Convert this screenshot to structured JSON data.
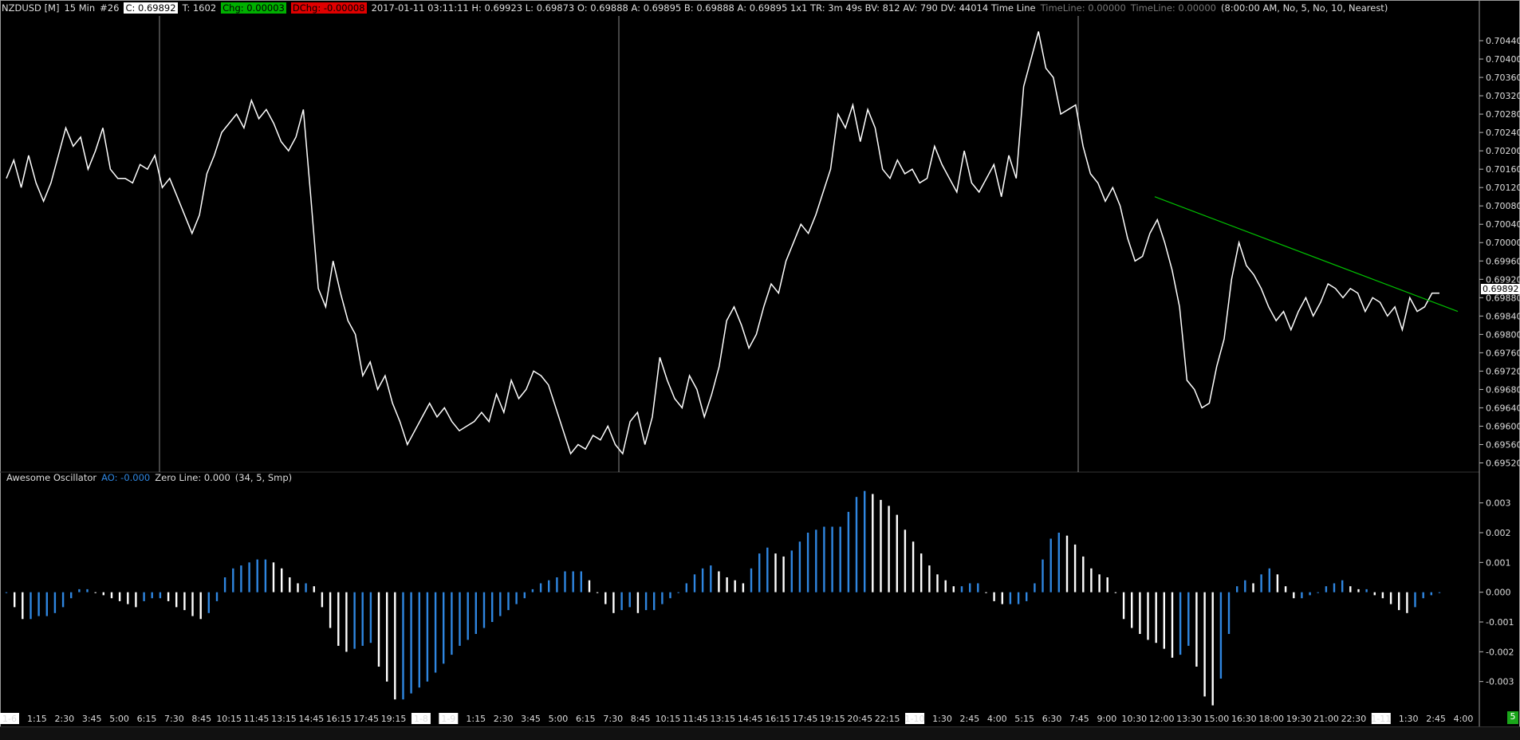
{
  "header": {
    "symbol": "NZDUSD [M]",
    "interval": "15 Min",
    "bar_no": "#26",
    "close_box": "C: 0.69892",
    "ticks": "T: 1602",
    "chg": "Chg: 0.00003",
    "dchg": "DChg: -0.00008",
    "stats": "2017-01-11 03:11:11  H: 0.69923  L: 0.69873  O: 0.69888  A: 0.69895  B: 0.69888  A: 0.69895 1x1  TR: 3m 49s  BV: 812  AV: 790  DV: 44014  Time Line",
    "timeline1": "TimeLine: 0.00000",
    "timeline2": "TimeLine: 0.00000",
    "session": "(8:00:00 AM, No, 5, No, 10, Nearest)"
  },
  "indicator_header": {
    "name": "Awesome Oscillator",
    "ao": "AO: -0.000",
    "zero": "Zero Line: 0.000",
    "params": "(34, 5, Smp)"
  },
  "last_price_label": "0.69892",
  "scroll_badge": "5",
  "colors": {
    "price_line": "#ffffff",
    "trend_line": "#00c000",
    "ao_up": "#2f86e0",
    "ao_down": "#ffffff",
    "session_line": "#8a8a8a"
  },
  "chart_data": [
    {
      "type": "line",
      "series": [
        {
          "values": [
            0.7014,
            0.7018,
            0.7012,
            0.7019,
            0.7013,
            0.7009,
            0.7013,
            0.7019,
            0.7025,
            0.7021,
            0.7023,
            0.7016,
            0.702,
            0.7025,
            0.7016,
            0.7014,
            0.7014,
            0.7013,
            0.7017,
            0.7016,
            0.7019,
            0.7012,
            0.7014,
            0.701,
            0.7006,
            0.7002,
            0.7006,
            0.7015,
            0.7019,
            0.7024,
            0.7026,
            0.7028,
            0.7025,
            0.7031,
            0.7027,
            0.7029,
            0.7026,
            0.7022,
            0.702,
            0.7023,
            0.7029,
            0.701,
            0.699,
            0.6986,
            0.6996,
            0.6989,
            0.6983,
            0.698,
            0.6971,
            0.6974,
            0.6968,
            0.6971,
            0.6965,
            0.6961,
            0.6956,
            0.6959,
            0.6962,
            0.6965,
            0.6962,
            0.6964,
            0.6961,
            0.6959,
            0.696,
            0.6961,
            0.6963,
            0.6961,
            0.6967,
            0.6963,
            0.697,
            0.6966,
            0.6968,
            0.6972,
            0.6971,
            0.6969,
            0.6964,
            0.6959,
            0.6954,
            0.6956,
            0.6955,
            0.6958,
            0.6957,
            0.696,
            0.6956,
            0.6954,
            0.6961,
            0.6963,
            0.6956,
            0.6962,
            0.6975,
            0.697,
            0.6966,
            0.6964,
            0.6971,
            0.6968,
            0.6962,
            0.6967,
            0.6973,
            0.6983,
            0.6986,
            0.6982,
            0.6977,
            0.698,
            0.6986,
            0.6991,
            0.6989,
            0.6996,
            0.7,
            0.7004,
            0.7002,
            0.7006,
            0.7011,
            0.7016,
            0.7028,
            0.7025,
            0.703,
            0.7022,
            0.7029,
            0.7025,
            0.7016,
            0.7014,
            0.7018,
            0.7015,
            0.7016,
            0.7013,
            0.7014,
            0.7021,
            0.7017,
            0.7014,
            0.7011,
            0.702,
            0.7013,
            0.7011,
            0.7014,
            0.7017,
            0.701,
            0.7019,
            0.7014,
            0.7034,
            0.704,
            0.7046,
            0.7038,
            0.7036,
            0.7028,
            0.7029,
            0.703,
            0.7021,
            0.7015,
            0.7013,
            0.7009,
            0.7012,
            0.7008,
            0.7001,
            0.6996,
            0.6997,
            0.7002,
            0.7005,
            0.7,
            0.6994,
            0.6986,
            0.697,
            0.6968,
            0.6964,
            0.6965,
            0.6973,
            0.6979,
            0.6992,
            0.7,
            0.6995,
            0.6993,
            0.699,
            0.6986,
            0.6983,
            0.6985,
            0.6981,
            0.6985,
            0.6988,
            0.6984,
            0.6987,
            0.6991,
            0.699,
            0.6988,
            0.699,
            0.6989,
            0.6985,
            0.6988,
            0.6987,
            0.6984,
            0.6986,
            0.6981,
            0.6988,
            0.6985,
            0.6986,
            0.6989,
            0.6989
          ]
        }
      ],
      "ylim": [
        0.695,
        0.7048
      ],
      "y_ticks": [
        "0.70440",
        "0.70400",
        "0.70360",
        "0.70320",
        "0.70280",
        "0.70240",
        "0.70200",
        "0.70160",
        "0.70120",
        "0.70080",
        "0.70040",
        "0.70000",
        "0.69960",
        "0.69920",
        "0.69880",
        "0.69840",
        "0.69800",
        "0.69760",
        "0.69720",
        "0.69680",
        "0.69640",
        "0.69600",
        "0.69560",
        "0.69520"
      ],
      "trendline": {
        "from": [
          0.701
        ],
        "to": [
          0.6985
        ]
      }
    },
    {
      "type": "bar",
      "series": [
        {
          "values": [
            0.0,
            -0.0005,
            -0.0009,
            -0.0009,
            -0.0008,
            -0.0008,
            -0.0007,
            -0.0005,
            -0.0002,
            0.0001,
            0.0001,
            0.0,
            -0.0001,
            -0.0002,
            -0.0003,
            -0.0004,
            -0.0005,
            -0.0003,
            -0.0002,
            -0.0002,
            -0.0003,
            -0.0005,
            -0.0006,
            -0.0008,
            -0.0009,
            -0.0007,
            -0.0003,
            0.0005,
            0.0008,
            0.0009,
            0.001,
            0.0011,
            0.0011,
            0.001,
            0.0008,
            0.0005,
            0.0003,
            0.0003,
            0.0002,
            -0.0005,
            -0.0012,
            -0.0018,
            -0.002,
            -0.0019,
            -0.0018,
            -0.0017,
            -0.0025,
            -0.003,
            -0.0036,
            -0.0036,
            -0.0034,
            -0.0032,
            -0.003,
            -0.0027,
            -0.0024,
            -0.0021,
            -0.0018,
            -0.0016,
            -0.0014,
            -0.0012,
            -0.001,
            -0.0008,
            -0.0006,
            -0.0004,
            -0.0002,
            0.0001,
            0.0003,
            0.0004,
            0.0005,
            0.0007,
            0.0007,
            0.0007,
            0.0004,
            0.0,
            -0.0004,
            -0.0007,
            -0.0006,
            -0.0005,
            -0.0007,
            -0.0006,
            -0.0006,
            -0.0004,
            -0.0002,
            0.0,
            0.0003,
            0.0006,
            0.0008,
            0.0009,
            0.0007,
            0.0005,
            0.0004,
            0.0003,
            0.0008,
            0.0013,
            0.0015,
            0.0013,
            0.0012,
            0.0014,
            0.0017,
            0.002,
            0.0021,
            0.0022,
            0.0022,
            0.0022,
            0.0027,
            0.0032,
            0.0034,
            0.0033,
            0.0031,
            0.0029,
            0.0026,
            0.0021,
            0.0017,
            0.0013,
            0.0009,
            0.0006,
            0.0004,
            0.0002,
            0.0002,
            0.0003,
            0.0003,
            0.0,
            -0.0003,
            -0.0004,
            -0.0004,
            -0.0004,
            -0.0003,
            0.0003,
            0.0011,
            0.0018,
            0.002,
            0.0019,
            0.0016,
            0.0012,
            0.0008,
            0.0006,
            0.0005,
            0.0,
            -0.0009,
            -0.0012,
            -0.0014,
            -0.0016,
            -0.0017,
            -0.0019,
            -0.0022,
            -0.0021,
            -0.0018,
            -0.0025,
            -0.0035,
            -0.0038,
            -0.0029,
            -0.0014,
            0.0002,
            0.0004,
            0.0003,
            0.0006,
            0.0008,
            0.0006,
            0.0002,
            -0.0002,
            -0.0002,
            -0.0001,
            0.0,
            0.0002,
            0.0003,
            0.0004,
            0.0002,
            0.0001,
            0.0001,
            -0.0001,
            -0.0002,
            -0.0004,
            -0.0006,
            -0.0007,
            -0.0005,
            -0.0002,
            -0.0001,
            0.0
          ]
        }
      ],
      "ylim": [
        -0.004,
        0.0035
      ],
      "y_ticks": [
        "0.003",
        "0.002",
        "0.001",
        "0.000",
        "-0.001",
        "-0.002",
        "-0.003"
      ]
    }
  ],
  "x_axis": {
    "labels": [
      "1-6",
      "1:15",
      "2:30",
      "3:45",
      "5:00",
      "6:15",
      "7:30",
      "8:45",
      "10:15",
      "11:45",
      "13:15",
      "14:45",
      "16:15",
      "17:45",
      "19:15",
      "1-8",
      "1-9",
      "1:15",
      "2:30",
      "3:45",
      "5:00",
      "6:15",
      "7:30",
      "8:45",
      "10:15",
      "11:45",
      "13:15",
      "14:45",
      "16:15",
      "17:45",
      "19:15",
      "20:45",
      "22:15",
      "1-10",
      "1:30",
      "2:45",
      "4:00",
      "5:15",
      "6:30",
      "7:45",
      "9:00",
      "10:30",
      "12:00",
      "13:30",
      "15:00",
      "16:30",
      "18:00",
      "19:30",
      "21:00",
      "22:30",
      "1-11",
      "1:30",
      "2:45",
      "4:00"
    ],
    "highlighted": [
      "1-6",
      "1-8",
      "1-9",
      "1-10",
      "1-11"
    ]
  }
}
